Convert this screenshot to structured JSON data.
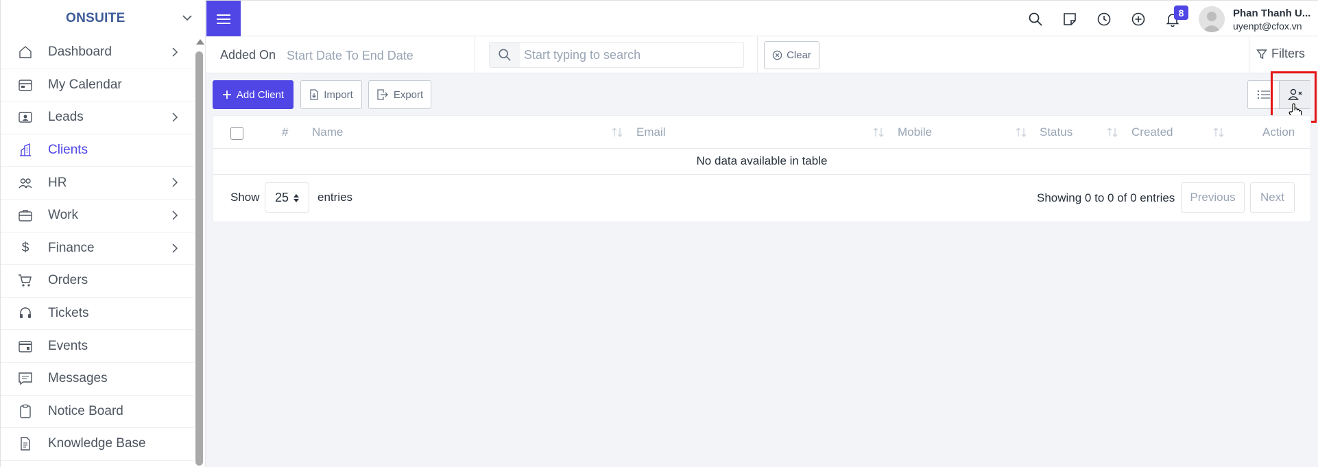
{
  "brand": {
    "name": "ONSUITE"
  },
  "sidebar": {
    "items": [
      {
        "label": "Dashboard",
        "icon": "house-icon",
        "has_arrow": true
      },
      {
        "label": "My Calendar",
        "icon": "calendar-icon",
        "has_arrow": false
      },
      {
        "label": "Leads",
        "icon": "id-card-icon",
        "has_arrow": true
      },
      {
        "label": "Clients",
        "icon": "building-icon",
        "has_arrow": false,
        "active": true
      },
      {
        "label": "HR",
        "icon": "people-icon",
        "has_arrow": true
      },
      {
        "label": "Work",
        "icon": "briefcase-icon",
        "has_arrow": true
      },
      {
        "label": "Finance",
        "icon": "dollar-icon",
        "has_arrow": true
      },
      {
        "label": "Orders",
        "icon": "cart-icon",
        "has_arrow": false
      },
      {
        "label": "Tickets",
        "icon": "headset-icon",
        "has_arrow": false
      },
      {
        "label": "Events",
        "icon": "calendar-event-icon",
        "has_arrow": false
      },
      {
        "label": "Messages",
        "icon": "chat-icon",
        "has_arrow": false
      },
      {
        "label": "Notice Board",
        "icon": "clipboard-icon",
        "has_arrow": false
      },
      {
        "label": "Knowledge Base",
        "icon": "document-icon",
        "has_arrow": false
      }
    ]
  },
  "topbar": {
    "notification_count": "8",
    "user_name": "Phan Thanh U...",
    "user_email": "uyenpt@cfox.vn"
  },
  "filters": {
    "added_on_label": "Added On",
    "date_placeholder": "Start Date To End Date",
    "search_placeholder": "Start typing to search",
    "clear_label": "Clear",
    "filters_label": "Filters"
  },
  "actions": {
    "add_client": "Add Client",
    "import": "Import",
    "export": "Export"
  },
  "table": {
    "columns": [
      "#",
      "Name",
      "Email",
      "Mobile",
      "Status",
      "Created",
      "Action"
    ],
    "empty_message": "No data available in table",
    "show_label": "Show",
    "page_length": "25",
    "entries_label": "entries",
    "info": "Showing 0 to 0 of 0 entries",
    "previous": "Previous",
    "next": "Next"
  },
  "colors": {
    "accent": "#4f46e5",
    "highlight": "#e31414",
    "muted_text": "#99a5b5"
  }
}
